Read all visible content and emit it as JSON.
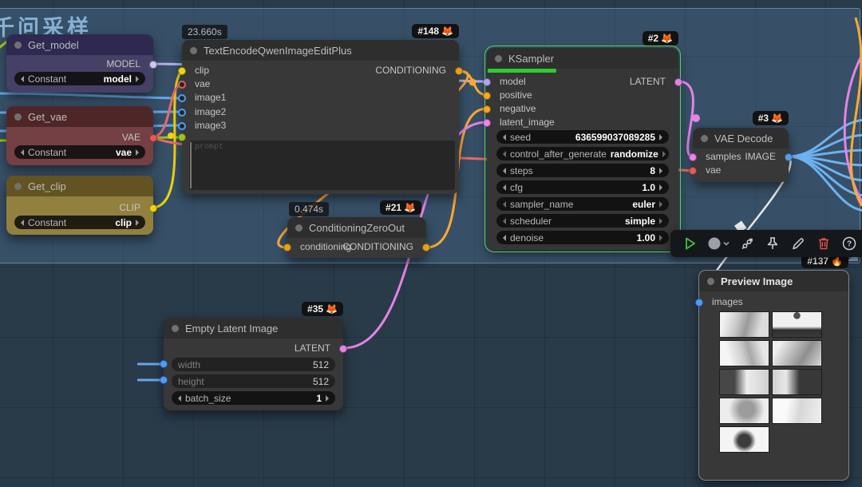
{
  "canvas": {
    "group_title": "千问采样"
  },
  "nodes": {
    "get_model": {
      "title": "Get_model",
      "output_label": "MODEL",
      "widget": {
        "label": "Constant",
        "value": "model"
      }
    },
    "get_vae": {
      "title": "Get_vae",
      "output_label": "VAE",
      "widget": {
        "label": "Constant",
        "value": "vae"
      }
    },
    "get_clip": {
      "title": "Get_clip",
      "output_label": "CLIP",
      "widget": {
        "label": "Constant",
        "value": "clip"
      }
    },
    "text_encode": {
      "timer": "23.660s",
      "badge": "#148",
      "badge_emoji": "🦊",
      "title": "TextEncodeQwenImageEditPlus",
      "inputs": [
        "clip",
        "vae",
        "image1",
        "image2",
        "image3"
      ],
      "output_label": "CONDITIONING",
      "prompt_placeholder": "prompt"
    },
    "cond_zero": {
      "timer": "0.474s",
      "badge": "#21",
      "badge_emoji": "🦊",
      "title": "ConditioningZeroOut",
      "input_label": "conditioning",
      "output_label": "CONDITIONING"
    },
    "ksampler": {
      "badge": "#2",
      "badge_emoji": "🦊",
      "title": "KSampler",
      "inputs": [
        "model",
        "positive",
        "negative",
        "latent_image"
      ],
      "output_label": "LATENT",
      "progress_percent": 36,
      "widgets": [
        {
          "label": "seed",
          "value": "636599037089285"
        },
        {
          "label": "control_after_generate",
          "value": "randomize"
        },
        {
          "label": "steps",
          "value": "8"
        },
        {
          "label": "cfg",
          "value": "1.0"
        },
        {
          "label": "sampler_name",
          "value": "euler"
        },
        {
          "label": "scheduler",
          "value": "simple"
        },
        {
          "label": "denoise",
          "value": "1.00"
        }
      ]
    },
    "vae_decode": {
      "badge": "#3",
      "badge_emoji": "🦊",
      "title": "VAE Decode",
      "inputs": [
        "samples",
        "vae"
      ],
      "output_label": "IMAGE"
    },
    "preview_image": {
      "badge": "#137",
      "badge_emoji": "🔥",
      "title": "Preview Image",
      "input_label": "images",
      "thumbnail_count": 9
    },
    "empty_latent": {
      "badge": "#35",
      "badge_emoji": "🦊",
      "title": "Empty Latent Image",
      "output_label": "LATENT",
      "widgets": [
        {
          "label": "width",
          "value": "512"
        },
        {
          "label": "height",
          "value": "512"
        },
        {
          "label": "batch_size",
          "value": "1"
        }
      ]
    }
  },
  "toolbar": {
    "icons": [
      "run",
      "color-swatch",
      "bypass",
      "pin",
      "edit",
      "delete",
      "help"
    ]
  },
  "colors": {
    "link_model": "#b8aef2",
    "link_clip": "#f0d50c",
    "link_vae": "#e86a6a",
    "link_image": "#63a7e8",
    "link_conditioning": "#ffa931",
    "link_latent": "#e583e5",
    "selection": "#55d455"
  }
}
